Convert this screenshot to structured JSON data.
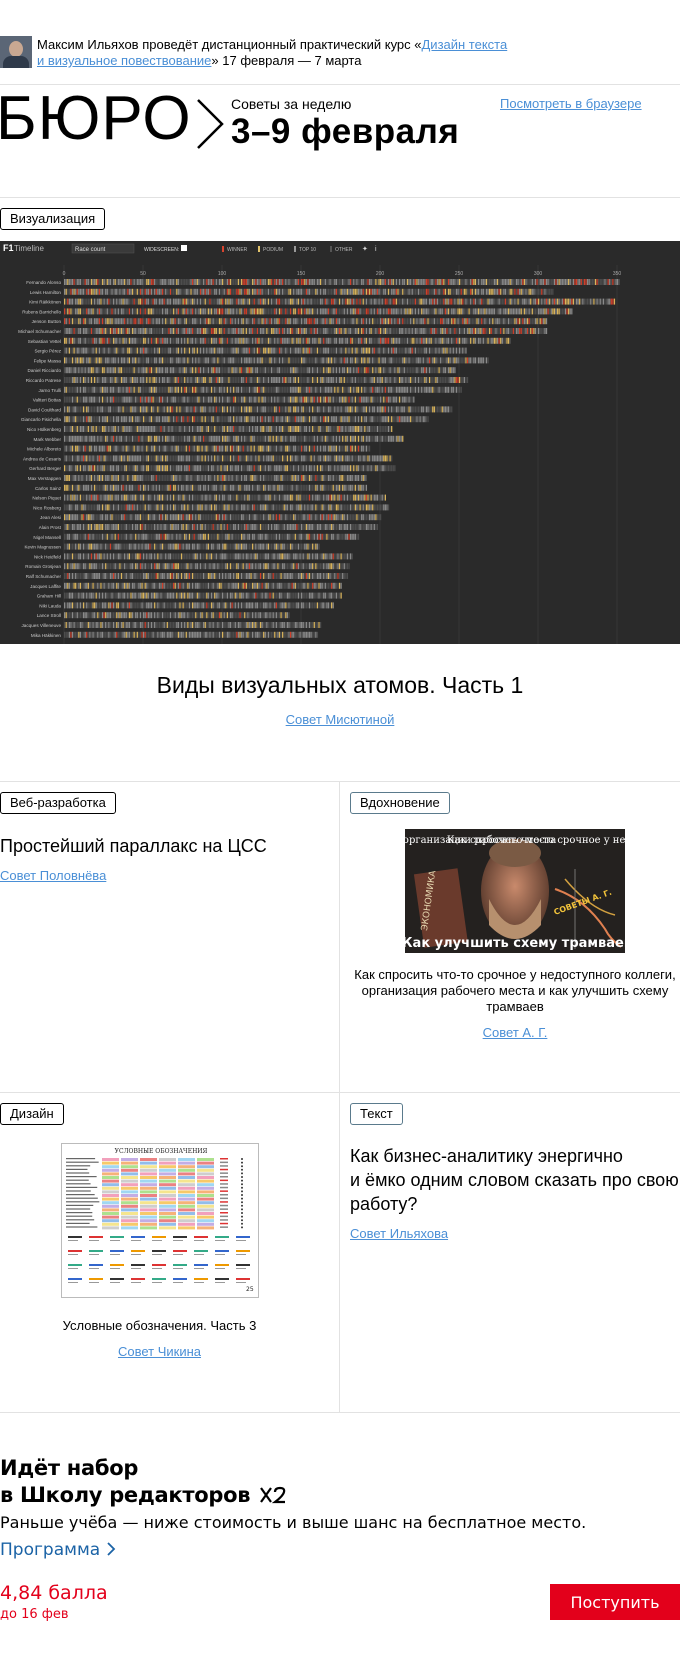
{
  "announcement": {
    "prefix": "Максим Ильяхов проведёт дистанционный практический курс «",
    "course_link_line1": "Дизайн текста",
    "course_link_line2": "и визуальное повествование",
    "suffix": "» 17 февраля — 7 марта"
  },
  "header": {
    "logo_text": "БЮРО",
    "week_label": "Советы за неделю",
    "week_title": "3–9 февраля",
    "browser_link": "Посмотреть в браузере"
  },
  "featured": {
    "tag": "Визуализация",
    "chart": {
      "logo": "F1",
      "logo_suffix": "Timeline",
      "select_value": "Race count",
      "widescreen_label": "WIDESCREEN",
      "legend": [
        {
          "label": "WINNER",
          "color": "#d8442f"
        },
        {
          "label": "PODIUM",
          "color": "#e2c36b"
        },
        {
          "label": "TOP 10",
          "color": "#9a9a9a"
        },
        {
          "label": "OTHER",
          "color": "#555555"
        }
      ],
      "axis_ticks": [
        "0",
        "50",
        "100",
        "150",
        "200",
        "250",
        "300",
        "350"
      ],
      "drivers": [
        "Fernando Alonso",
        "Lewis Hamilton",
        "Kimi Räikkönen",
        "Rubens Barrichello",
        "Jenson Button",
        "Michael Schumacher",
        "Sebastian Vettel",
        "Sergio Pérez",
        "Felipe Massa",
        "Daniel Ricciardo",
        "Riccardo Patrese",
        "Jarno Trulli",
        "Valtteri Bottas",
        "David Coulthard",
        "Giancarlo Fisichella",
        "Nico Hülkenberg",
        "Mark Webber",
        "Michele Alboreto",
        "Andrea de Cesaris",
        "Gerhard Berger",
        "Max Verstappen",
        "Carlos Sainz",
        "Nelson Piquet",
        "Nico Rosberg",
        "Jean Alesi",
        "Alain Prost",
        "Nigel Mansell",
        "Kevin Magnussen",
        "Nick Heidfeld",
        "Romain Grosjean",
        "Ralf Schumacher",
        "Jacques Laffite",
        "Graham Hill",
        "Niki Lauda",
        "Lance Stroll",
        "Jacques Villeneuve",
        "Mika Häkkinen"
      ],
      "race_counts": [
        352,
        310,
        349,
        322,
        306,
        306,
        283,
        255,
        269,
        248,
        256,
        252,
        222,
        246,
        231,
        208,
        215,
        194,
        208,
        210,
        192,
        192,
        204,
        206,
        201,
        199,
        187,
        162,
        183,
        181,
        180,
        176,
        176,
        171,
        143,
        163,
        161
      ]
    },
    "title": "Виды визуальных атомов. Часть 1",
    "author": "Совет Мисютиной"
  },
  "cards": [
    {
      "tag": "Веб-разработка",
      "title": "Простейший параллакс на ЦСС",
      "author": "Совет Половнёва"
    },
    {
      "tag": "Вдохновение",
      "thumb_text_left": "Что почитать об организации рабочего места",
      "thumb_text_right": "Как спросить что-то срочное у недоступного коллеги",
      "thumb_text_bottom": "Как улучшить схему трамваев",
      "thumb_book": "ЭКОНОМИКА",
      "thumb_badge": "СОВЕТЫ А. Г.",
      "caption": "Как спросить что-то срочное у недоступного коллеги, организация рабочего места и как улучшить схему трамваев",
      "author": "Совет А. Г."
    },
    {
      "tag": "Дизайн",
      "thumb_heading": "УСЛОВНЫЕ ОБОЗНАЧЕНИЯ",
      "thumb_page": "25",
      "caption": "Условные обозначения. Часть 3",
      "author": "Совет Чикина"
    },
    {
      "tag": "Текст",
      "title_line1": "Как бизнес-аналитику энергично",
      "title_line2": "и ёмко одним словом сказать про свою работу?",
      "author": "Совет Ильяхова"
    }
  ],
  "school": {
    "title_line1": "Идёт набор",
    "title_line2": "в Школу редакторов",
    "subtitle": "Раньше учёба — ниже стоимость и выше шанс на бесплатное место.",
    "program_link": "Программа",
    "price": "4,84 балла",
    "deadline": "до 16 фев",
    "apply_button": "Поступить"
  }
}
